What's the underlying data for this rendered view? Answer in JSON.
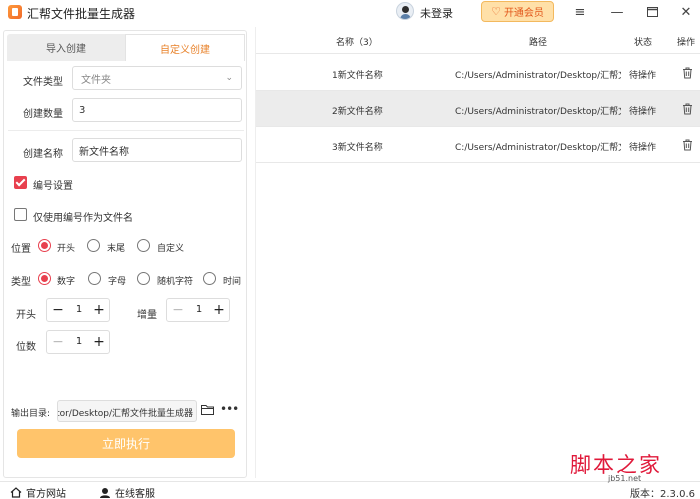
{
  "titlebar": {
    "app_title": "汇帮文件批量生成器",
    "login_text": "未登录",
    "vip_label": "开通会员"
  },
  "left": {
    "tabs": [
      {
        "label": "导入创建",
        "active": false
      },
      {
        "label": "自定义创建",
        "active": true
      }
    ],
    "file_type_label": "文件类型",
    "file_type_value": "文件夹",
    "count_label": "创建数量",
    "count_value": "3",
    "name_label": "创建名称",
    "name_value": "新文件名称",
    "numbering_label": "编号设置",
    "numbering_checked": true,
    "only_number_label": "仅使用编号作为文件名",
    "only_number_checked": false,
    "position_label": "位置",
    "position_options": [
      "开头",
      "末尾",
      "自定义"
    ],
    "position_selected": "开头",
    "type_label": "类型",
    "type_options": [
      "数字",
      "字母",
      "随机字符",
      "时间"
    ],
    "type_selected": "数字",
    "start_label": "开头",
    "start_value": "1",
    "increment_label": "增量",
    "increment_value": "1",
    "digits_label": "位数",
    "digits_value": "1",
    "output_label": "输出目录:",
    "output_path": "C:/Users/Administrator/Desktop/汇帮文件批量生成器",
    "run_label": "立即执行"
  },
  "table": {
    "columns": [
      "名称（3）",
      "路径",
      "状态",
      "操作"
    ],
    "rows": [
      {
        "name": "1新文件名称",
        "path": "C:/Users/Administrator/Desktop/汇帮文",
        "status": "待操作"
      },
      {
        "name": "2新文件名称",
        "path": "C:/Users/Administrator/Desktop/汇帮文",
        "status": "待操作"
      },
      {
        "name": "3新文件名称",
        "path": "C:/Users/Administrator/Desktop/汇帮文",
        "status": "待操作"
      }
    ],
    "selected_row": 1
  },
  "bottombar": {
    "website_label": "官方网站",
    "support_label": "在线客服",
    "version_label": "版本：2.3.0.6"
  },
  "watermark": {
    "main": "脚本之家",
    "sub": "jb51.net"
  },
  "colors": {
    "accent_orange": "#e8822a",
    "run_button": "#ffc46b",
    "checked_red": "#e8404e",
    "vip_bg": "#ffe0a8"
  }
}
